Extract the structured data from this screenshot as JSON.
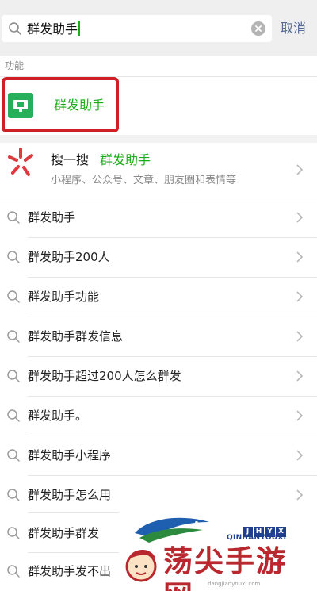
{
  "search": {
    "query": "群发助手",
    "cancel_label": "取消"
  },
  "features": {
    "section_label": "功能",
    "item_title": "群发助手"
  },
  "sou_yi_sou": {
    "title": "搜一搜",
    "keyword": "群发助手",
    "subtitle": "小程序、公众号、文章、朋友圈和表情等"
  },
  "suggestions": [
    "群发助手",
    "群发助手200人",
    "群发助手功能",
    "群发助手群发信息",
    "群发助手超过200人怎么群发",
    "群发助手。",
    "群发助手小程序",
    "群发助手怎么用",
    "群发助手群发",
    "群发助手发不出"
  ],
  "watermark": {
    "badge": [
      "J",
      "H",
      "Y",
      "X"
    ],
    "brand_en": "QINHANYOUXI",
    "brand_cn": "荡尖手游网",
    "url": "dangjianyouxi.com"
  },
  "colors": {
    "accent_green": "#1aad19",
    "highlight_red": "#cf2027",
    "cancel_blue": "#576b95"
  }
}
